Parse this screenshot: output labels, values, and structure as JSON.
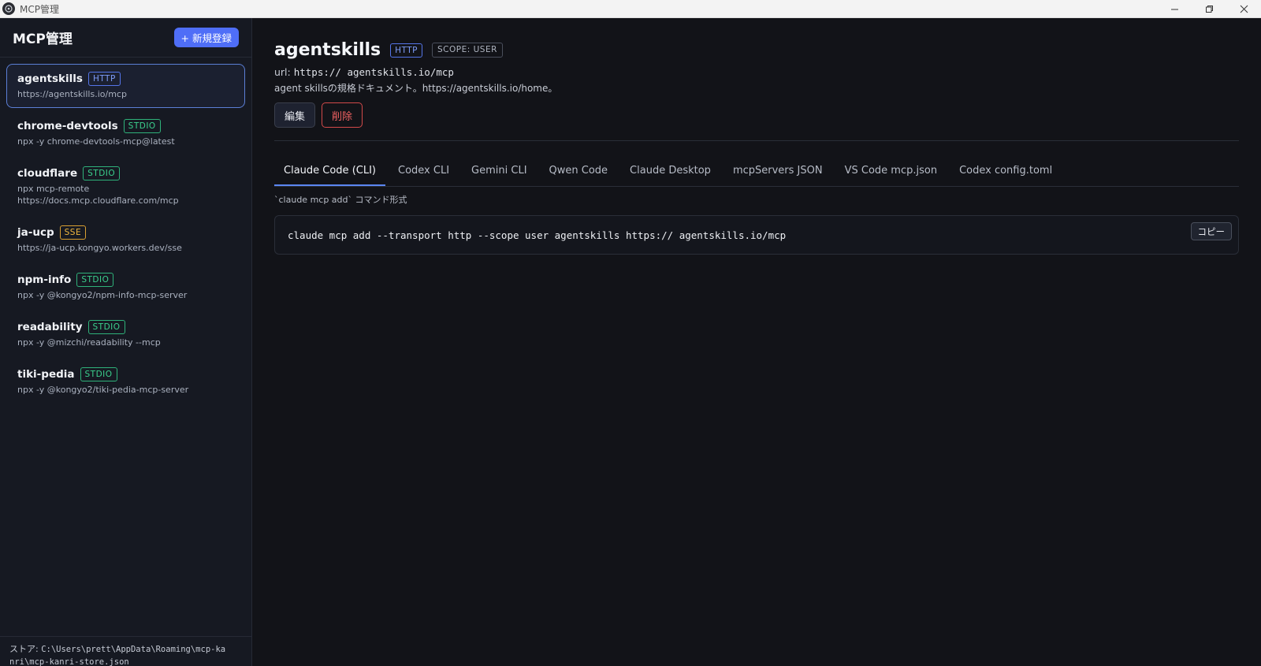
{
  "window": {
    "title": "MCP管理"
  },
  "sidebar": {
    "title": "MCP管理",
    "new_button": "+ 新規登録",
    "items": [
      {
        "name": "agentskills",
        "type": "HTTP",
        "desc": "https://agentskills.io/mcp"
      },
      {
        "name": "chrome-devtools",
        "type": "STDIO",
        "desc": "npx -y chrome-devtools-mcp@latest"
      },
      {
        "name": "cloudflare",
        "type": "STDIO",
        "desc": "npx mcp-remote",
        "desc2": "https://docs.mcp.cloudflare.com/mcp"
      },
      {
        "name": "ja-ucp",
        "type": "SSE",
        "desc": "https://ja-ucp.kongyo.workers.dev/sse"
      },
      {
        "name": "npm-info",
        "type": "STDIO",
        "desc": "npx -y @kongyo2/npm-info-mcp-server"
      },
      {
        "name": "readability",
        "type": "STDIO",
        "desc": "npx -y @mizchi/readability --mcp"
      },
      {
        "name": "tiki-pedia",
        "type": "STDIO",
        "desc": "npx -y @kongyo2/tiki-pedia-mcp-server"
      }
    ],
    "footer_label": "ストア: ",
    "footer_path1": "C:\\Users\\prett\\AppData\\Roaming\\mcp-ka",
    "footer_path2": "nri\\mcp-kanri-store.json"
  },
  "detail": {
    "name": "agentskills",
    "type": "HTTP",
    "scope": "SCOPE: USER",
    "url_label": "url: ",
    "url": "https:// agentskills.io/mcp",
    "description": "agent skillsの規格ドキュメント。https://agentskills.io/home。",
    "edit_button": "編集",
    "delete_button": "削除"
  },
  "tabs": [
    "Claude Code (CLI)",
    "Codex CLI",
    "Gemini CLI",
    "Qwen Code",
    "Claude Desktop",
    "mcpServers JSON",
    "VS Code mcp.json",
    "Codex config.toml"
  ],
  "active_tab": "Claude Code (CLI)",
  "command": {
    "hint": "`claude mcp add` コマンド形式",
    "text": "claude mcp add --transport http --scope user agentskills https:// agentskills.io/mcp",
    "copy_button": "コピー"
  }
}
